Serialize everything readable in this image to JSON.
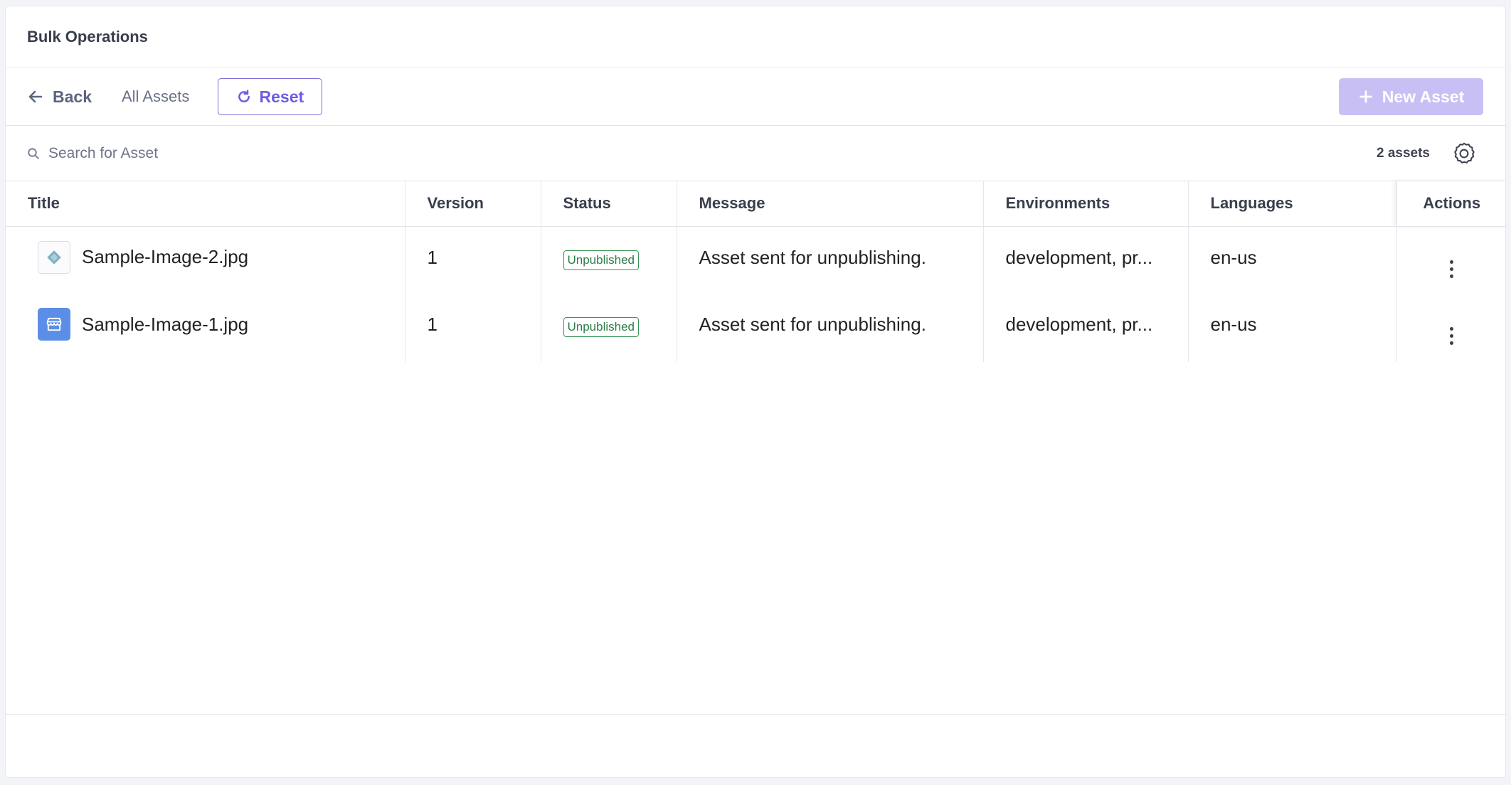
{
  "header": {
    "title": "Bulk Operations"
  },
  "toolbar": {
    "back_label": "Back",
    "all_assets_label": "All Assets",
    "reset_label": "Reset",
    "new_asset_label": "New Asset"
  },
  "search": {
    "placeholder": "Search for Asset",
    "count_label": "2 assets"
  },
  "table": {
    "columns": [
      "Title",
      "Version",
      "Status",
      "Message",
      "Environments",
      "Languages",
      "Actions"
    ],
    "rows": [
      {
        "title": "Sample-Image-2.jpg",
        "version": "1",
        "status": "Unpublished",
        "message": "Asset sent for unpublishing.",
        "environments": "development, pr...",
        "languages": "en-us"
      },
      {
        "title": "Sample-Image-1.jpg",
        "version": "1",
        "status": "Unpublished",
        "message": "Asset sent for unpublishing.",
        "environments": "development, pr...",
        "languages": "en-us"
      }
    ]
  },
  "colors": {
    "accent": "#6c5ce7",
    "new_asset_disabled": "#c8c0f4",
    "status_green": "#2a7d45"
  }
}
